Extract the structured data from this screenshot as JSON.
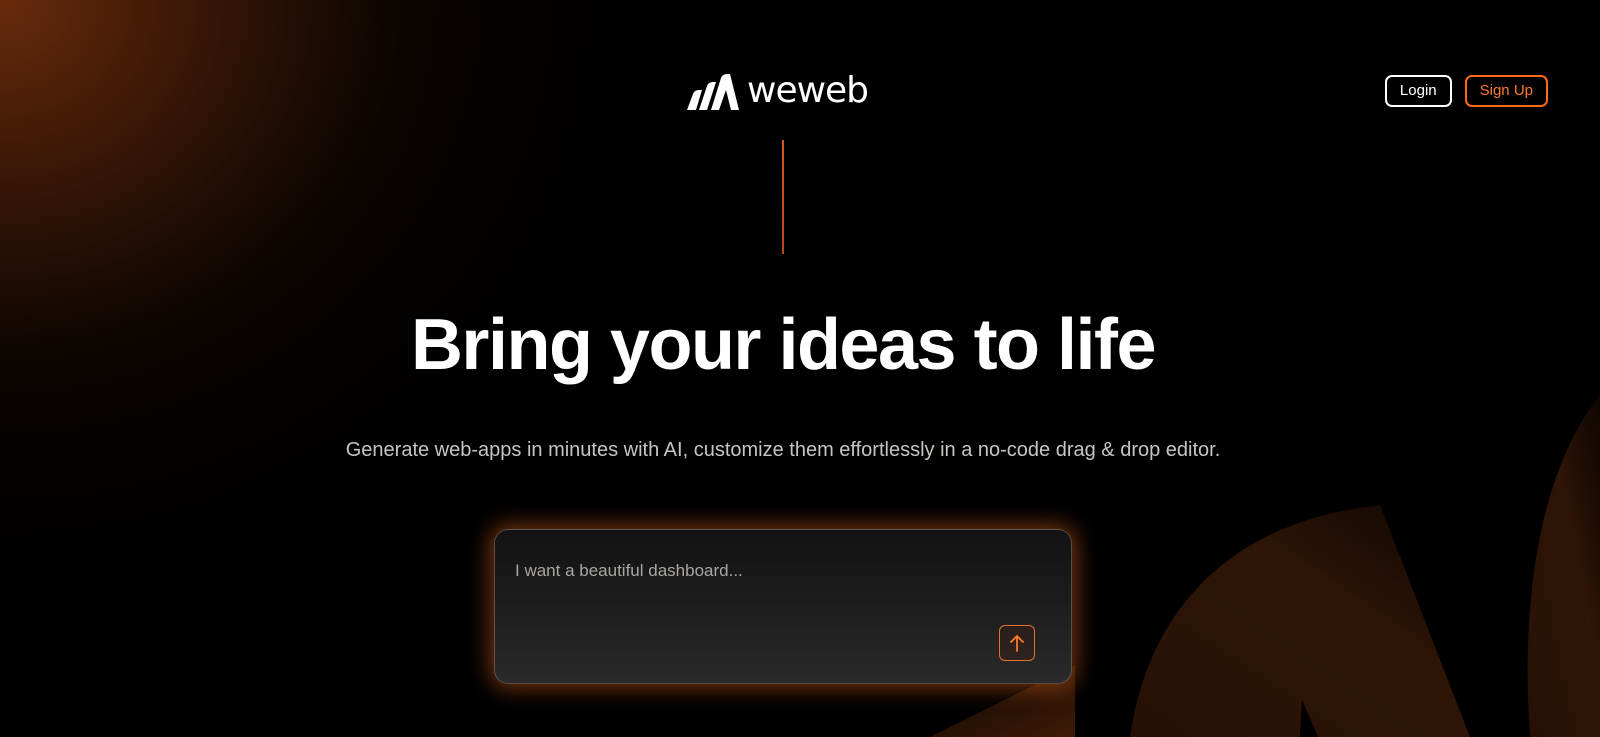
{
  "brand": {
    "name": "weweb",
    "logo_icon": "weweb-mark-icon"
  },
  "header": {
    "login_label": "Login",
    "signup_label": "Sign Up"
  },
  "hero": {
    "headline": "Bring your ideas to life",
    "subtitle": "Generate web-apps in minutes with AI, customize them effortlessly in a no-code drag & drop editor."
  },
  "prompt": {
    "placeholder": "I want a beautiful dashboard...",
    "value": "",
    "submit_icon": "arrow-up-icon"
  },
  "colors": {
    "accent": "#ff6a1a",
    "background": "#000000",
    "text": "#ffffff",
    "subtitle": "#c9c4c0"
  }
}
